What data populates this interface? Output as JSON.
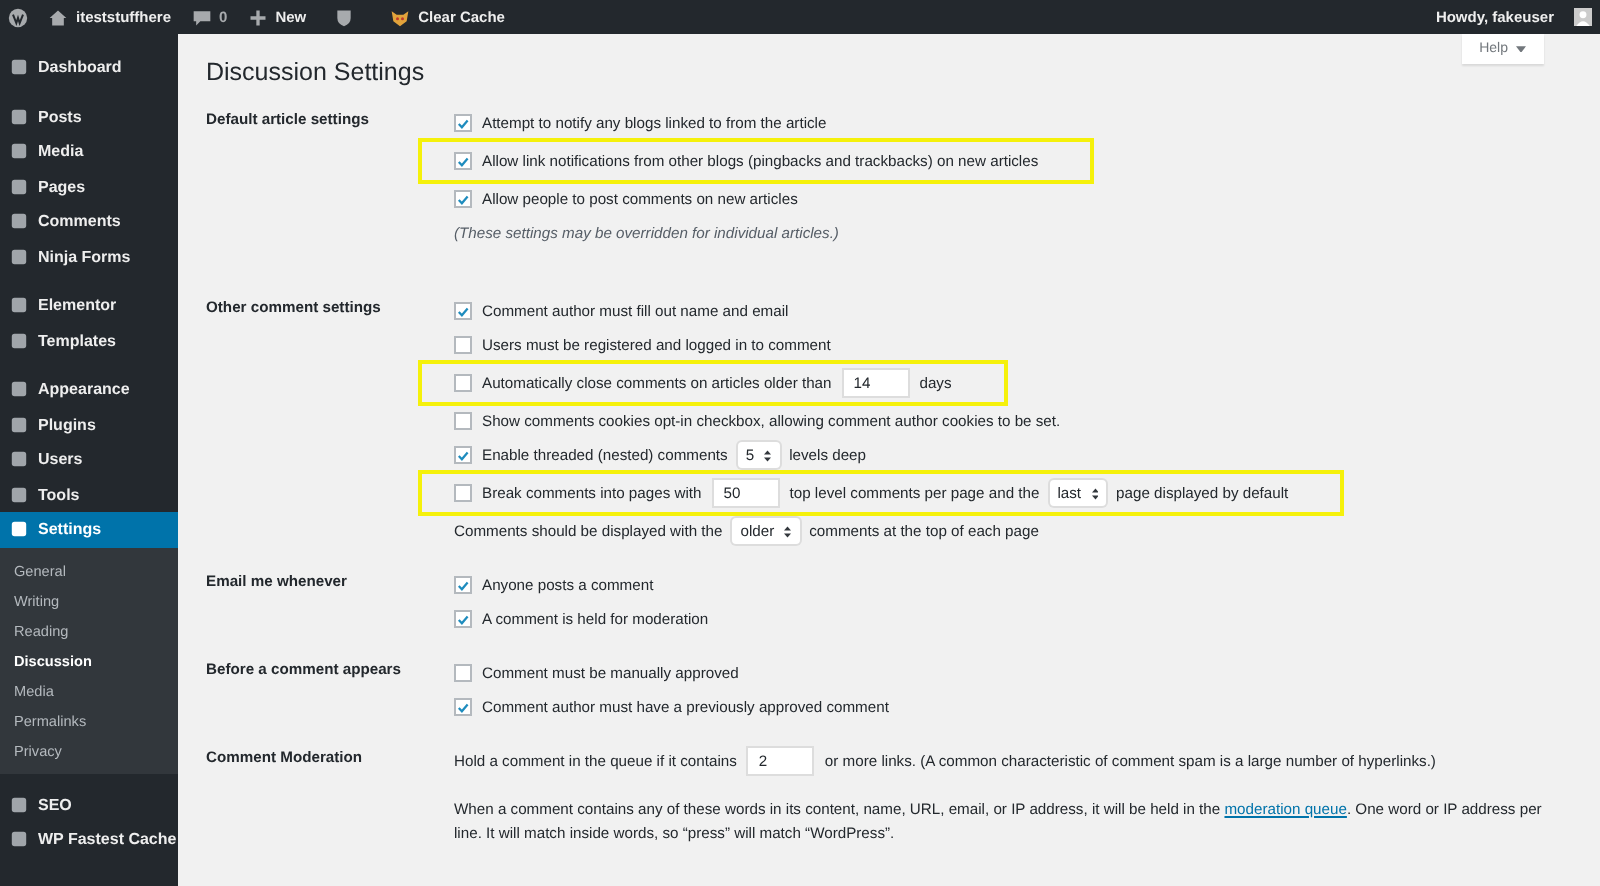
{
  "admin_bar": {
    "site_name": "iteststuffhere",
    "comments_count": "0",
    "new_label": "New",
    "clear_cache_label": "Clear Cache",
    "greeting": "Howdy, fakeuser"
  },
  "help_button": "Help",
  "sidebar": {
    "items": [
      {
        "kind": "item",
        "label": "Dashboard",
        "selected": false
      },
      {
        "kind": "separator"
      },
      {
        "kind": "item",
        "label": "Posts",
        "selected": false
      },
      {
        "kind": "item",
        "label": "Media",
        "selected": false
      },
      {
        "kind": "item",
        "label": "Pages",
        "selected": false
      },
      {
        "kind": "item",
        "label": "Comments",
        "selected": false
      },
      {
        "kind": "item",
        "label": "Ninja Forms",
        "selected": false
      },
      {
        "kind": "separator"
      },
      {
        "kind": "item",
        "label": "Elementor",
        "selected": false
      },
      {
        "kind": "item",
        "label": "Templates",
        "selected": false
      },
      {
        "kind": "separator"
      },
      {
        "kind": "item",
        "label": "Appearance",
        "selected": false
      },
      {
        "kind": "item",
        "label": "Plugins",
        "selected": false
      },
      {
        "kind": "item",
        "label": "Users",
        "selected": false
      },
      {
        "kind": "item",
        "label": "Tools",
        "selected": false
      },
      {
        "kind": "item",
        "label": "Settings",
        "selected": true,
        "submenu": [
          {
            "label": "General",
            "selected": false
          },
          {
            "label": "Writing",
            "selected": false
          },
          {
            "label": "Reading",
            "selected": false
          },
          {
            "label": "Discussion",
            "selected": true
          },
          {
            "label": "Media",
            "selected": false
          },
          {
            "label": "Permalinks",
            "selected": false
          },
          {
            "label": "Privacy",
            "selected": false
          }
        ]
      },
      {
        "kind": "separator"
      },
      {
        "kind": "item",
        "label": "SEO",
        "selected": false
      },
      {
        "kind": "item",
        "label": "WP Fastest Cache",
        "selected": false
      }
    ]
  },
  "page_title": "Discussion Settings",
  "sections": [
    {
      "label": "Default article settings",
      "rows": [
        {
          "kind": "checkbox",
          "checked": true,
          "highlighted": false,
          "parts": [
            {
              "kind": "text",
              "value": "Attempt to notify any blogs linked to from the article"
            }
          ]
        },
        {
          "kind": "checkbox",
          "checked": true,
          "highlighted": true,
          "parts": [
            {
              "kind": "text",
              "value": "Allow link notifications from other blogs (pingbacks and trackbacks) on new articles"
            }
          ]
        },
        {
          "kind": "checkbox",
          "checked": true,
          "highlighted": false,
          "parts": [
            {
              "kind": "text",
              "value": "Allow people to post comments on new articles"
            }
          ]
        },
        {
          "kind": "note",
          "highlighted": false,
          "parts": [
            {
              "kind": "text",
              "value": "(These settings may be overridden for individual articles.)"
            }
          ]
        }
      ]
    },
    {
      "label": "Other comment settings",
      "rows": [
        {
          "kind": "checkbox",
          "checked": true,
          "highlighted": false,
          "parts": [
            {
              "kind": "text",
              "value": "Comment author must fill out name and email"
            }
          ]
        },
        {
          "kind": "checkbox",
          "checked": false,
          "highlighted": false,
          "parts": [
            {
              "kind": "text",
              "value": "Users must be registered and logged in to comment"
            }
          ]
        },
        {
          "kind": "checkbox",
          "checked": false,
          "highlighted": true,
          "parts": [
            {
              "kind": "text",
              "value": "Automatically close comments on articles older than"
            },
            {
              "kind": "input",
              "value": "14"
            },
            {
              "kind": "text",
              "value": "days"
            }
          ]
        },
        {
          "kind": "checkbox",
          "checked": false,
          "highlighted": false,
          "parts": [
            {
              "kind": "text",
              "value": "Show comments cookies opt-in checkbox, allowing comment author cookies to be set."
            }
          ]
        },
        {
          "kind": "checkbox",
          "checked": true,
          "highlighted": false,
          "parts": [
            {
              "kind": "text",
              "value": "Enable threaded (nested) comments"
            },
            {
              "kind": "select",
              "value": "5"
            },
            {
              "kind": "text",
              "value": "levels deep"
            }
          ]
        },
        {
          "kind": "checkbox",
          "checked": false,
          "highlighted": true,
          "parts": [
            {
              "kind": "text",
              "value": "Break comments into pages with"
            },
            {
              "kind": "input",
              "value": "50"
            },
            {
              "kind": "text",
              "value": "top level comments per page and the"
            },
            {
              "kind": "select",
              "value": "last"
            },
            {
              "kind": "text",
              "value": "page displayed by default"
            }
          ]
        },
        {
          "kind": "line",
          "highlighted": false,
          "parts": [
            {
              "kind": "text",
              "value": "Comments should be displayed with the"
            },
            {
              "kind": "select",
              "value": "older"
            },
            {
              "kind": "text",
              "value": "comments at the top of each page"
            }
          ]
        }
      ]
    },
    {
      "label": "Email me whenever",
      "rows": [
        {
          "kind": "checkbox",
          "checked": true,
          "highlighted": false,
          "parts": [
            {
              "kind": "text",
              "value": "Anyone posts a comment"
            }
          ]
        },
        {
          "kind": "checkbox",
          "checked": true,
          "highlighted": false,
          "parts": [
            {
              "kind": "text",
              "value": "A comment is held for moderation"
            }
          ]
        }
      ]
    },
    {
      "label": "Before a comment appears",
      "rows": [
        {
          "kind": "checkbox",
          "checked": false,
          "highlighted": false,
          "parts": [
            {
              "kind": "text",
              "value": "Comment must be manually approved"
            }
          ]
        },
        {
          "kind": "checkbox",
          "checked": true,
          "highlighted": false,
          "parts": [
            {
              "kind": "text",
              "value": "Comment author must have a previously approved comment"
            }
          ]
        }
      ]
    },
    {
      "label": "Comment Moderation",
      "rows": [
        {
          "kind": "line",
          "highlighted": false,
          "parts": [
            {
              "kind": "text",
              "value": "Hold a comment in the queue if it contains"
            },
            {
              "kind": "input",
              "value": "2"
            },
            {
              "kind": "text",
              "value": "or more links. (A common characteristic of comment spam is a large number of hyperlinks.)"
            }
          ]
        },
        {
          "kind": "paragraph",
          "highlighted": false,
          "parts": [
            {
              "kind": "text",
              "value": "When a comment contains any of these words in its content, name, URL, email, or IP address, it will be held in the"
            },
            {
              "kind": "link",
              "value": "moderation queue"
            },
            {
              "kind": "text",
              "value": ". One word or IP address per line. It will match inside words, so “press” will match “WordPress”."
            }
          ]
        }
      ]
    }
  ]
}
